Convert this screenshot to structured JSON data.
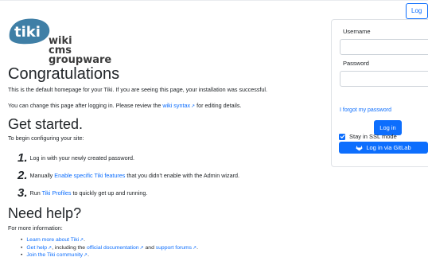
{
  "header": {
    "login_button": "Log in"
  },
  "logo": {
    "icon_text": "tiki",
    "line1": "wiki",
    "line2": "cms",
    "line3": "groupware"
  },
  "content": {
    "heading": "Congratulations",
    "intro": "This is the default homepage for your Tiki. If you are seeing this page, your installation was successful.",
    "change_prefix": "You can change this page after logging in. Please review the ",
    "change_link": "wiki syntax",
    "change_suffix": " for editing details.",
    "started_heading": "Get started.",
    "started_intro": "To begin configuring your site:",
    "step1_num": "1.",
    "step1_text": "Log in with your newly created password.",
    "step2_num": "2.",
    "step2_prefix": "Manually ",
    "step2_link": "Enable specific Tiki features",
    "step2_suffix": " that you didn't enable with the Admin wizard.",
    "step3_num": "3.",
    "step3_prefix": "Run ",
    "step3_link": "Tiki Profiles",
    "step3_suffix": " to quickly get up and running.",
    "help_heading": "Need help?",
    "help_intro": "For more information:",
    "bullet1_link": "Learn more about Tiki",
    "bullet1_suffix": ".",
    "bullet2_link": "Get help",
    "bullet2_middle": ", including the ",
    "bullet2_link2": "official documentation",
    "bullet2_and": " and ",
    "bullet2_link3": "support forums",
    "bullet2_suffix": ".",
    "bullet3_link": "Join the Tiki community",
    "bullet3_suffix": "."
  },
  "login_panel": {
    "username_label": "Username",
    "username_value": "",
    "password_label": "Password",
    "password_value": "",
    "forgot_link": "I forgot my password",
    "login_button": "Log in",
    "ssl_label": "Stay in SSL mode",
    "ssl_checked": true,
    "gitlab_button": "Log in via GitLab"
  },
  "colors": {
    "link": "#0d6efd",
    "primary": "#0d6efd",
    "text": "#212529"
  }
}
